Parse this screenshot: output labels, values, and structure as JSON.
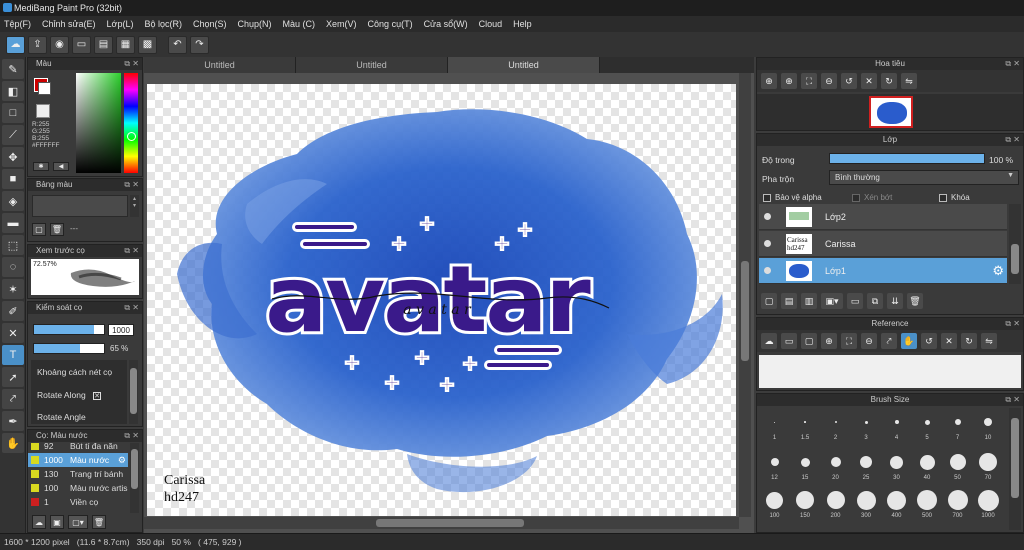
{
  "title": "MediBang Paint Pro (32bit)",
  "menu": [
    "Tệp(F)",
    "Chỉnh sửa(E)",
    "Lớp(L)",
    "Bộ lọc(R)",
    "Chọn(S)",
    "Chụp(N)",
    "Màu (C)",
    "Xem(V)",
    "Công cụ(T)",
    "Cửa sổ(W)",
    "Cloud",
    "Help"
  ],
  "toolbar_icons": [
    "cloud-icon",
    "upload-icon",
    "chat-icon",
    "comment-icon",
    "page-icon",
    "grid-icon",
    "tiles-icon",
    "undo-icon",
    "redo-icon"
  ],
  "tools": [
    "brush",
    "eraser",
    "rect-select",
    "line",
    "move",
    "fill-rect",
    "bucket",
    "gradient",
    "lasso-select",
    "polygon-select",
    "magic-wand",
    "select-pen",
    "select-eraser",
    "text",
    "operation",
    "eyedropper",
    "pen",
    "hand"
  ],
  "panels": {
    "color": {
      "title": "Màu",
      "r": "R:255",
      "g": "G:255",
      "b": "B:255",
      "hex": "#FFFFFF",
      "primary_color": "#ffffff",
      "secondary_color": "#cc0000"
    },
    "palette": {
      "title": "Bảng màu",
      "footer": "---"
    },
    "brush_preview": {
      "title": "Xem trước cọ",
      "value": "72.57%"
    },
    "brush_control": {
      "title": "Kiểm soát cọ",
      "size_value": "1000",
      "size_fraction": 0.85,
      "opacity_value": "65 %",
      "opacity_fraction": 0.65,
      "opt1": "Khoảng cách nét cọ",
      "opt2": "Rotate Along",
      "opt3": "Rotate Angle"
    },
    "brush_list": {
      "title": "Cọ: Màu nước",
      "items": [
        {
          "size": "92",
          "name": "Bút tỉ đa năn",
          "color": "#d8d820",
          "active": false
        },
        {
          "size": "1000",
          "name": "Màu nước",
          "color": "#d8d820",
          "active": true
        },
        {
          "size": "130",
          "name": "Trang trí bánh",
          "color": "#d8d820",
          "active": false
        },
        {
          "size": "100",
          "name": "Màu nước artis",
          "color": "#d8d820",
          "active": false
        },
        {
          "size": "1",
          "name": "Viền cọ",
          "color": "#cc2020",
          "active": false
        }
      ]
    }
  },
  "tabs": [
    {
      "label": "Untitled",
      "active": false
    },
    {
      "label": "Untitled",
      "active": false
    },
    {
      "label": "Untitled",
      "active": true
    }
  ],
  "artwork": {
    "title_text": "avatar",
    "script_text": "a v a t a r",
    "signature_line1": "Carissa",
    "signature_line2": "hd247",
    "blob_color": "#1b50c0",
    "text_color": "#5a2aa8"
  },
  "navigator": {
    "title": "Hoa tiêu"
  },
  "layers": {
    "title": "Lớp",
    "opacity_label": "Độ trong",
    "opacity_value": "100 %",
    "opacity_fraction": 1.0,
    "blend_label": "Pha trộn",
    "blend_value": "Bình thường",
    "protect_alpha": "Bảo vệ alpha",
    "clipping": "Xén bớt",
    "lock": "Khóa",
    "items": [
      {
        "name": "Lớp2",
        "active": false
      },
      {
        "name": "Carissa",
        "thumb_text1": "Carissa",
        "thumb_text2": "hd247",
        "active": false
      },
      {
        "name": "Lớp1",
        "active": true
      }
    ]
  },
  "reference": {
    "title": "Reference"
  },
  "brush_size": {
    "title": "Brush Size",
    "rows": [
      [
        "1",
        "1.5",
        "2",
        "3",
        "4",
        "5",
        "7",
        "10"
      ],
      [
        "12",
        "15",
        "20",
        "25",
        "30",
        "40",
        "50",
        "70"
      ],
      [
        "100",
        "150",
        "200",
        "300",
        "400",
        "500",
        "700",
        "1000"
      ]
    ]
  },
  "status": "1600 * 1200 pixel   (11.6 * 8.7cm)   350 dpi   50 %   ( 475, 929 )"
}
